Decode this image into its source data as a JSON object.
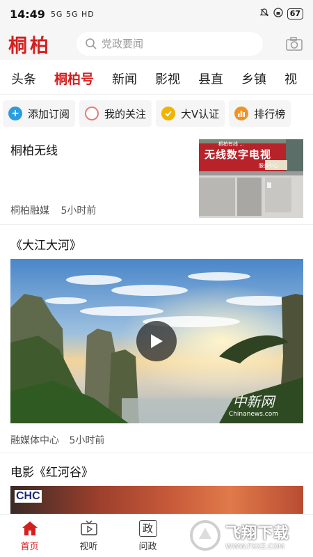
{
  "status_bar": {
    "time": "14:49",
    "signal_text": "5G 5G HD",
    "battery": "67"
  },
  "header": {
    "logo": "桐柏",
    "search_placeholder": "党政要闻"
  },
  "tabs": [
    {
      "label": "头条",
      "active": false
    },
    {
      "label": "桐柏号",
      "active": true
    },
    {
      "label": "新闻",
      "active": false
    },
    {
      "label": "影视",
      "active": false
    },
    {
      "label": "县直",
      "active": false
    },
    {
      "label": "乡镇",
      "active": false
    },
    {
      "label": "视",
      "active": false
    }
  ],
  "actions": [
    {
      "label": "添加订阅",
      "icon": "plus-icon",
      "color": "#2a9de0"
    },
    {
      "label": "我的关注",
      "icon": "circle-icon",
      "color": "#e97a7a"
    },
    {
      "label": "大V认证",
      "icon": "check-icon",
      "color": "#f0b400"
    },
    {
      "label": "排行榜",
      "icon": "bar-chart-icon",
      "color": "#f39222"
    }
  ],
  "feed": {
    "item1": {
      "title": "桐柏无线",
      "source": "桐柏融媒",
      "time": "5小时前",
      "thumb_sign": "无线数字电视",
      "thumb_sub": "服务中心",
      "thumb_top": "桐柏有线 ..."
    },
    "item2": {
      "title": "《大江大河》",
      "source": "融媒体中心",
      "time": "5小时前",
      "watermark": "中新网",
      "watermark_url": "Chinanews.com"
    },
    "item3": {
      "title": "电影《红河谷》",
      "logo_text": "CHC"
    }
  },
  "bottom_nav": {
    "items": [
      {
        "label": "首页",
        "icon": "home-icon",
        "active": true
      },
      {
        "label": "视听",
        "icon": "tv-icon",
        "active": false
      },
      {
        "label": "问政",
        "icon": "zheng-icon",
        "icon_text": "政",
        "active": false
      }
    ],
    "watermark": "飞翔下载",
    "watermark_url": "WWW.FXXZ.COM"
  },
  "colors": {
    "brand_red": "#d51f1f"
  }
}
